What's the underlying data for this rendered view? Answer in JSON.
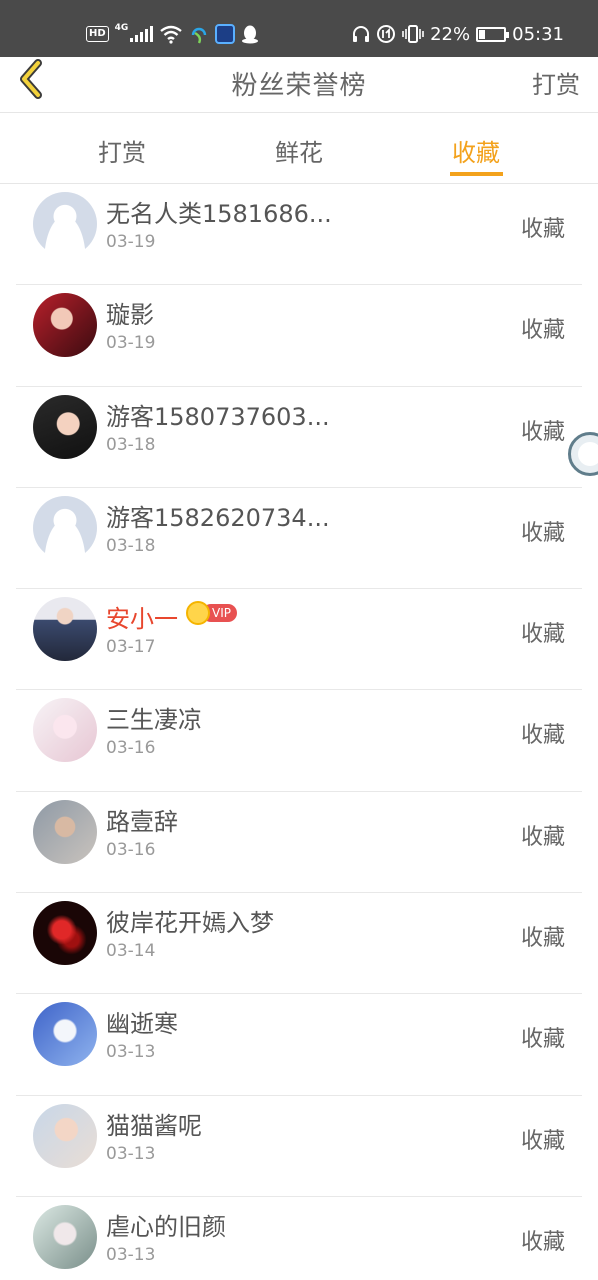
{
  "status_bar": {
    "hd_label": "HD",
    "network_label": "4G",
    "battery_percent": "22%",
    "battery_level": 0.22,
    "time": "05:31",
    "icons": [
      "hd-icon",
      "signal-icon",
      "wifi-icon",
      "headset-app-icon",
      "app-icon",
      "qq-icon",
      "headphones-icon",
      "data-saver-icon",
      "vibrate-icon",
      "battery-icon"
    ]
  },
  "header": {
    "back_icon": "chevron-left-icon",
    "title": "粉丝荣誉榜",
    "reward_label": "打赏"
  },
  "tabs": [
    {
      "label": "打赏",
      "active": false
    },
    {
      "label": "鲜花",
      "active": false
    },
    {
      "label": "收藏",
      "active": true
    }
  ],
  "accent_color": "#f3a21c",
  "vip_color": "#e8472e",
  "fans": [
    {
      "name": "无名人类1581686...",
      "date": "03-19",
      "action": "收藏",
      "avatar": "default-avatar",
      "vip": false
    },
    {
      "name": "璇影",
      "date": "03-19",
      "action": "收藏",
      "avatar": "user-avatar",
      "vip": false
    },
    {
      "name": "游客1580737603...",
      "date": "03-18",
      "action": "收藏",
      "avatar": "user-avatar",
      "vip": false
    },
    {
      "name": "游客1582620734...",
      "date": "03-18",
      "action": "收藏",
      "avatar": "default-avatar",
      "vip": false
    },
    {
      "name": "安小一",
      "date": "03-17",
      "action": "收藏",
      "avatar": "user-avatar",
      "vip": true,
      "vip_label": "VIP"
    },
    {
      "name": "三生凄凉",
      "date": "03-16",
      "action": "收藏",
      "avatar": "user-avatar",
      "vip": false
    },
    {
      "name": "路壹辞",
      "date": "03-16",
      "action": "收藏",
      "avatar": "user-avatar",
      "vip": false
    },
    {
      "name": "彼岸花开嫣入梦",
      "date": "03-14",
      "action": "收藏",
      "avatar": "user-avatar",
      "vip": false
    },
    {
      "name": "幽逝寒",
      "date": "03-13",
      "action": "收藏",
      "avatar": "user-avatar",
      "vip": false
    },
    {
      "name": "猫猫酱呢",
      "date": "03-13",
      "action": "收藏",
      "avatar": "user-avatar",
      "vip": false
    },
    {
      "name": "虐心的旧颜",
      "date": "03-13",
      "action": "收藏",
      "avatar": "user-avatar",
      "vip": false
    }
  ]
}
